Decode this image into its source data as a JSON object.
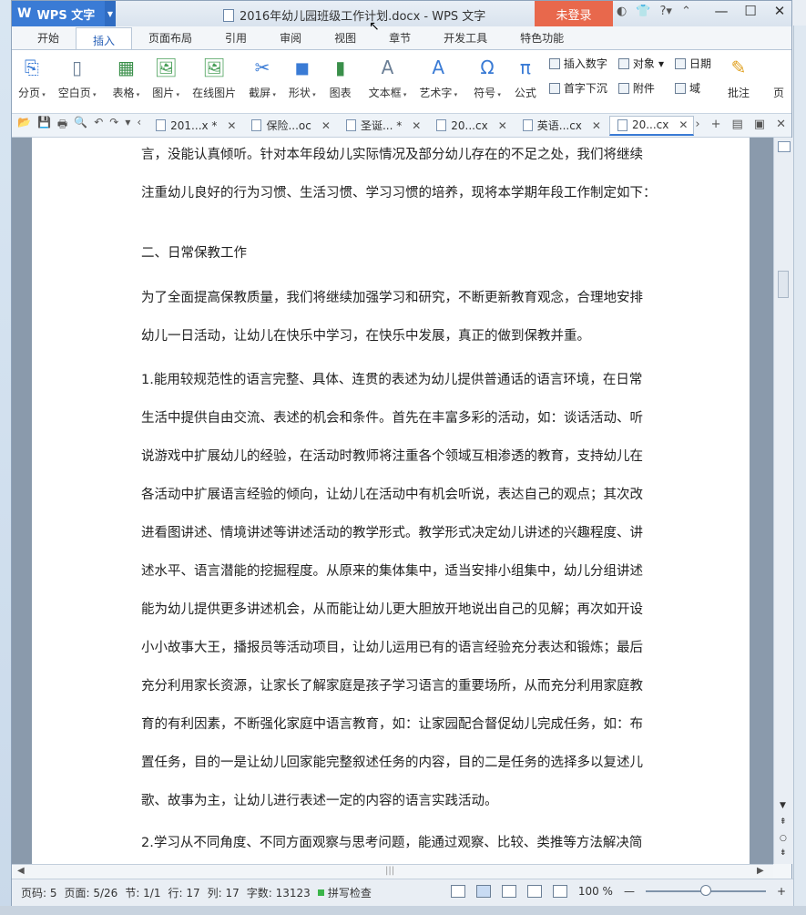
{
  "app": {
    "logo_label": "WPS 文字",
    "window_title": "2016年幼儿园班级工作计划.docx - WPS 文字",
    "login_label": "未登录"
  },
  "menu": {
    "tabs": [
      "开始",
      "插入",
      "页面布局",
      "引用",
      "审阅",
      "视图",
      "章节",
      "开发工具",
      "特色功能"
    ],
    "active_tab": "插入"
  },
  "ribbon": {
    "page_break": "分页",
    "blank_page": "空白页",
    "table": "表格",
    "picture": "图片",
    "online_picture": "在线图片",
    "screenshot": "截屏",
    "shapes": "形状",
    "chart": "图表",
    "textbox": "文本框",
    "wordart": "艺术字",
    "symbol": "符号",
    "formula": "公式",
    "insert_number": "插入数字",
    "drop_cap": "首字下沉",
    "object": "对象",
    "attachment": "附件",
    "date": "日期",
    "field": "域",
    "comment": "批注",
    "page_more": "页"
  },
  "doc_tabs": [
    {
      "label": "201...x *",
      "active": false
    },
    {
      "label": "保险...oc",
      "active": false
    },
    {
      "label": "圣诞... *",
      "active": false
    },
    {
      "label": "20...cx",
      "active": false
    },
    {
      "label": "英语...cx",
      "active": false
    },
    {
      "label": "20...cx",
      "active": true
    }
  ],
  "document": {
    "p0": [
      "言，没能认真倾听。针对本年段幼儿实际情况及部分幼儿存在的不足之处，我们将继续",
      "注重幼儿良好的行为习惯、生活习惯、学习习惯的培养，现将本学期年段工作制定如下："
    ],
    "heading2": "二、日常保教工作",
    "p1": [
      "为了全面提高保教质量，我们将继续加强学习和研究，不断更新教育观念，合理地安排",
      "幼儿一日活动，让幼儿在快乐中学习，在快乐中发展，真正的做到保教并重。"
    ],
    "p2": [
      "1.能用较规范性的语言完整、具体、连贯的表述为幼儿提供普通话的语言环境，在日常",
      "生活中提供自由交流、表述的机会和条件。首先在丰富多彩的活动，如：谈话活动、听",
      "说游戏中扩展幼儿的经验，在活动时教师将注重各个领域互相渗透的教育，支持幼儿在",
      "各活动中扩展语言经验的倾向，让幼儿在活动中有机会听说，表达自己的观点；其次改",
      "进看图讲述、情境讲述等讲述活动的教学形式。教学形式决定幼儿讲述的兴趣程度、讲",
      "述水平、语言潜能的挖掘程度。从原来的集体集中，适当安排小组集中，幼儿分组讲述",
      "能为幼儿提供更多讲述机会，从而能让幼儿更大胆放开地说出自己的见解；再次如开设",
      "小小故事大王，播报员等活动项目，让幼儿运用已有的语言经验充分表达和锻炼；最后",
      "充分利用家长资源，让家长了解家庭是孩子学习语言的重要场所，从而充分利用家庭教",
      "育的有利因素，不断强化家庭中语言教育，如：让家园配合督促幼儿完成任务，如：布",
      "置任务，目的一是让幼儿回家能完整叙述任务的内容，目的二是任务的选择多以复述儿",
      "歌、故事为主，让幼儿进行表述一定的内容的语言实践活动。"
    ],
    "p3": [
      "2.学习从不同角度、不同方面观察与思考问题，能通过观察、比较、类推等方法解决简"
    ]
  },
  "status": {
    "page_num": "页码: 5",
    "pages": "页面: 5/26",
    "section": "节: 1/1",
    "row": "行: 17",
    "col": "列: 17",
    "word_count": "字数: 13123",
    "spell_check": "拼写检查",
    "zoom": "100 %",
    "zoom_level": 0.5
  },
  "colors": {
    "brand_blue": "#3a7bd5",
    "login_orange": "#e8684c"
  }
}
